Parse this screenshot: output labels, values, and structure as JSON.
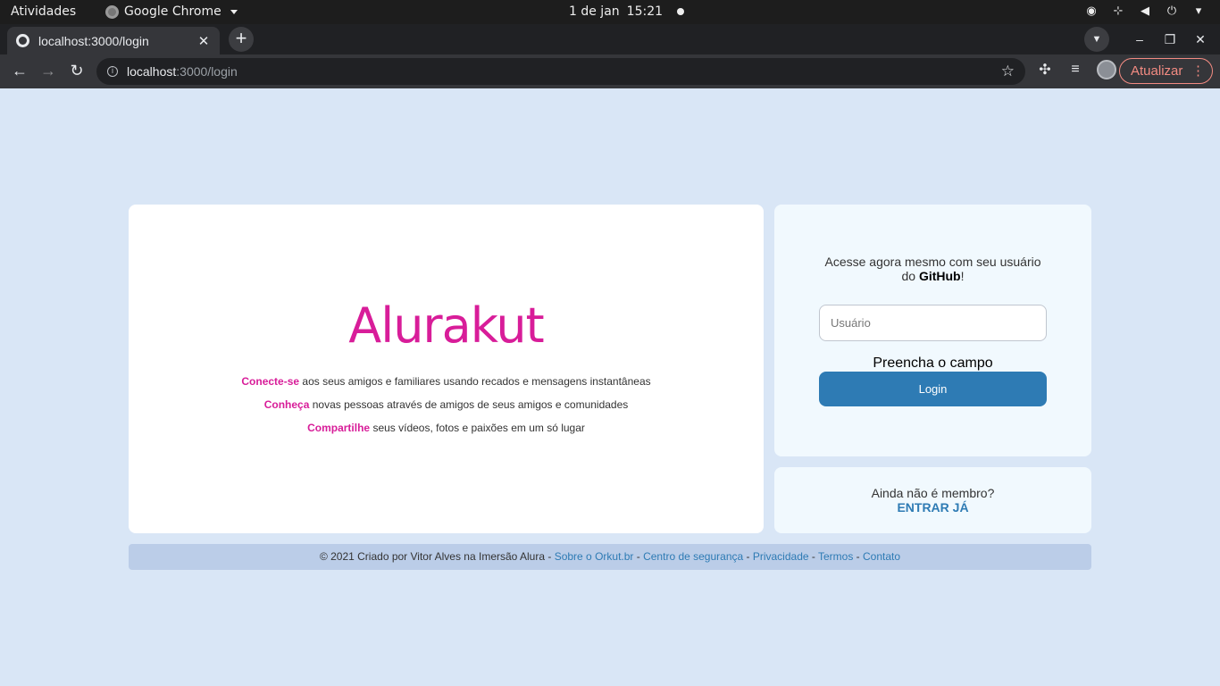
{
  "system": {
    "activities": "Atividades",
    "app_name": "Google Chrome",
    "date": "1 de jan",
    "time": "15:21"
  },
  "browser": {
    "tab_title": "localhost:3000/login",
    "url_host": "localhost",
    "url_rest": ":3000/login",
    "update_label": "Atualizar"
  },
  "welcome": {
    "logo": "Alurakut",
    "taglines": [
      {
        "highlight": "Conecte-se",
        "text": " aos seus amigos e familiares usando recados e mensagens instantâneas"
      },
      {
        "highlight": "Conheça",
        "text": " novas pessoas através de amigos de seus amigos e comunidades"
      },
      {
        "highlight": "Compartilhe",
        "text": " seus vídeos, fotos e paixões em um só lugar"
      }
    ]
  },
  "login": {
    "intro_line1": "Acesse agora mesmo com seu usuário",
    "intro_line2_pre": "do ",
    "intro_line2_bold": "GitHub",
    "intro_line2_post": "!",
    "username_placeholder": "Usuário",
    "username_value": "",
    "validation_message": "Preencha o campo",
    "submit_label": "Login"
  },
  "signup": {
    "question": "Ainda não é membro?",
    "link_label": "ENTRAR JÁ"
  },
  "footer": {
    "credit": "© 2021 Criado por Vitor Alves na Imersão Alura",
    "links": [
      "Sobre o Orkut.br",
      "Centro de segurança",
      "Privacidade",
      "Termos",
      "Contato"
    ]
  },
  "colors": {
    "brand_pink": "#D81D99",
    "brand_blue": "#2E7BB4",
    "page_bg": "#D9E6F6"
  }
}
